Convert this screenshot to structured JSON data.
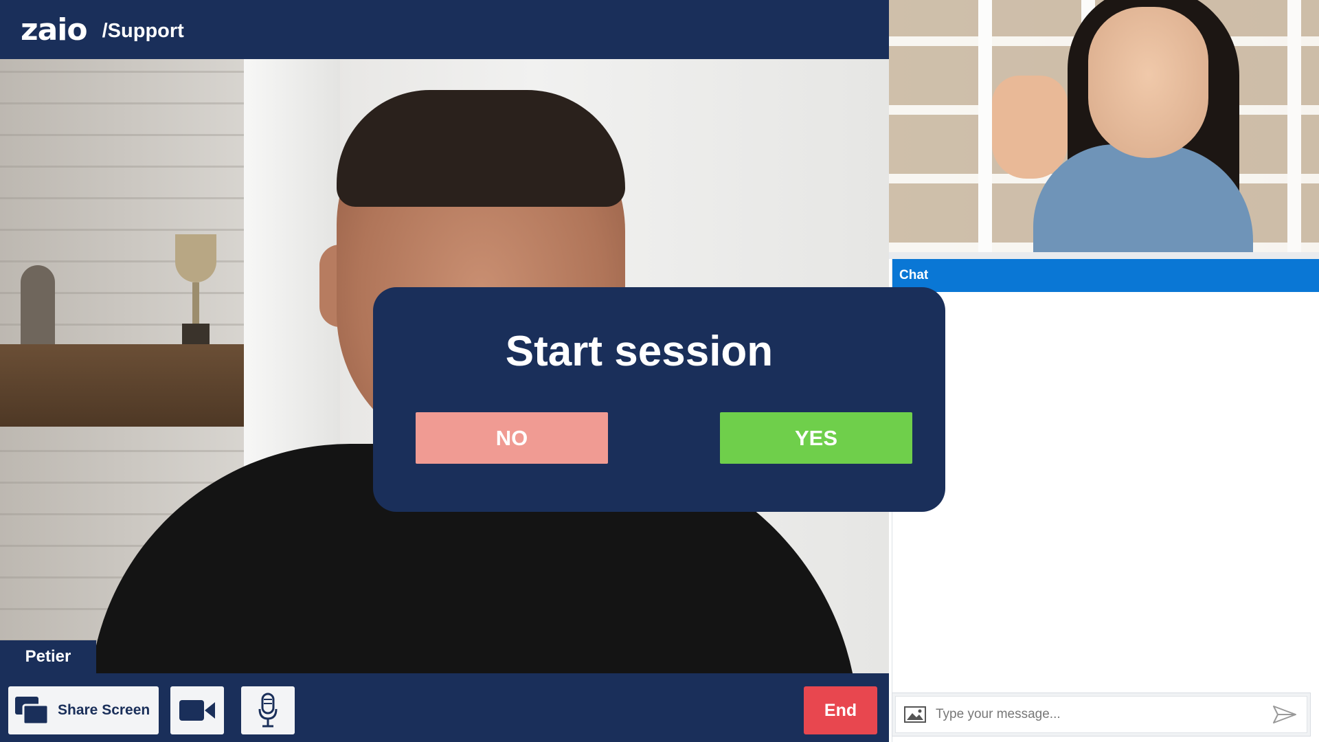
{
  "header": {
    "logo_text": "zaio",
    "section": "/Support"
  },
  "main_video": {
    "participant_name": "Petier"
  },
  "controls": {
    "share_screen_label": "Share Screen",
    "camera_icon": "video-camera-icon",
    "mic_icon": "microphone-icon",
    "end_label": "End"
  },
  "chat": {
    "title": "Chat",
    "input_placeholder": "Type your message...",
    "attach_icon": "image-icon",
    "send_icon": "send-icon"
  },
  "modal": {
    "title": "Start session",
    "no_label": "NO",
    "yes_label": "YES"
  },
  "colors": {
    "navy": "#1a2f5a",
    "chat_blue": "#0a77d5",
    "end_red": "#e8474f",
    "no_pink": "#f09b93",
    "yes_green": "#6fcf4b"
  }
}
